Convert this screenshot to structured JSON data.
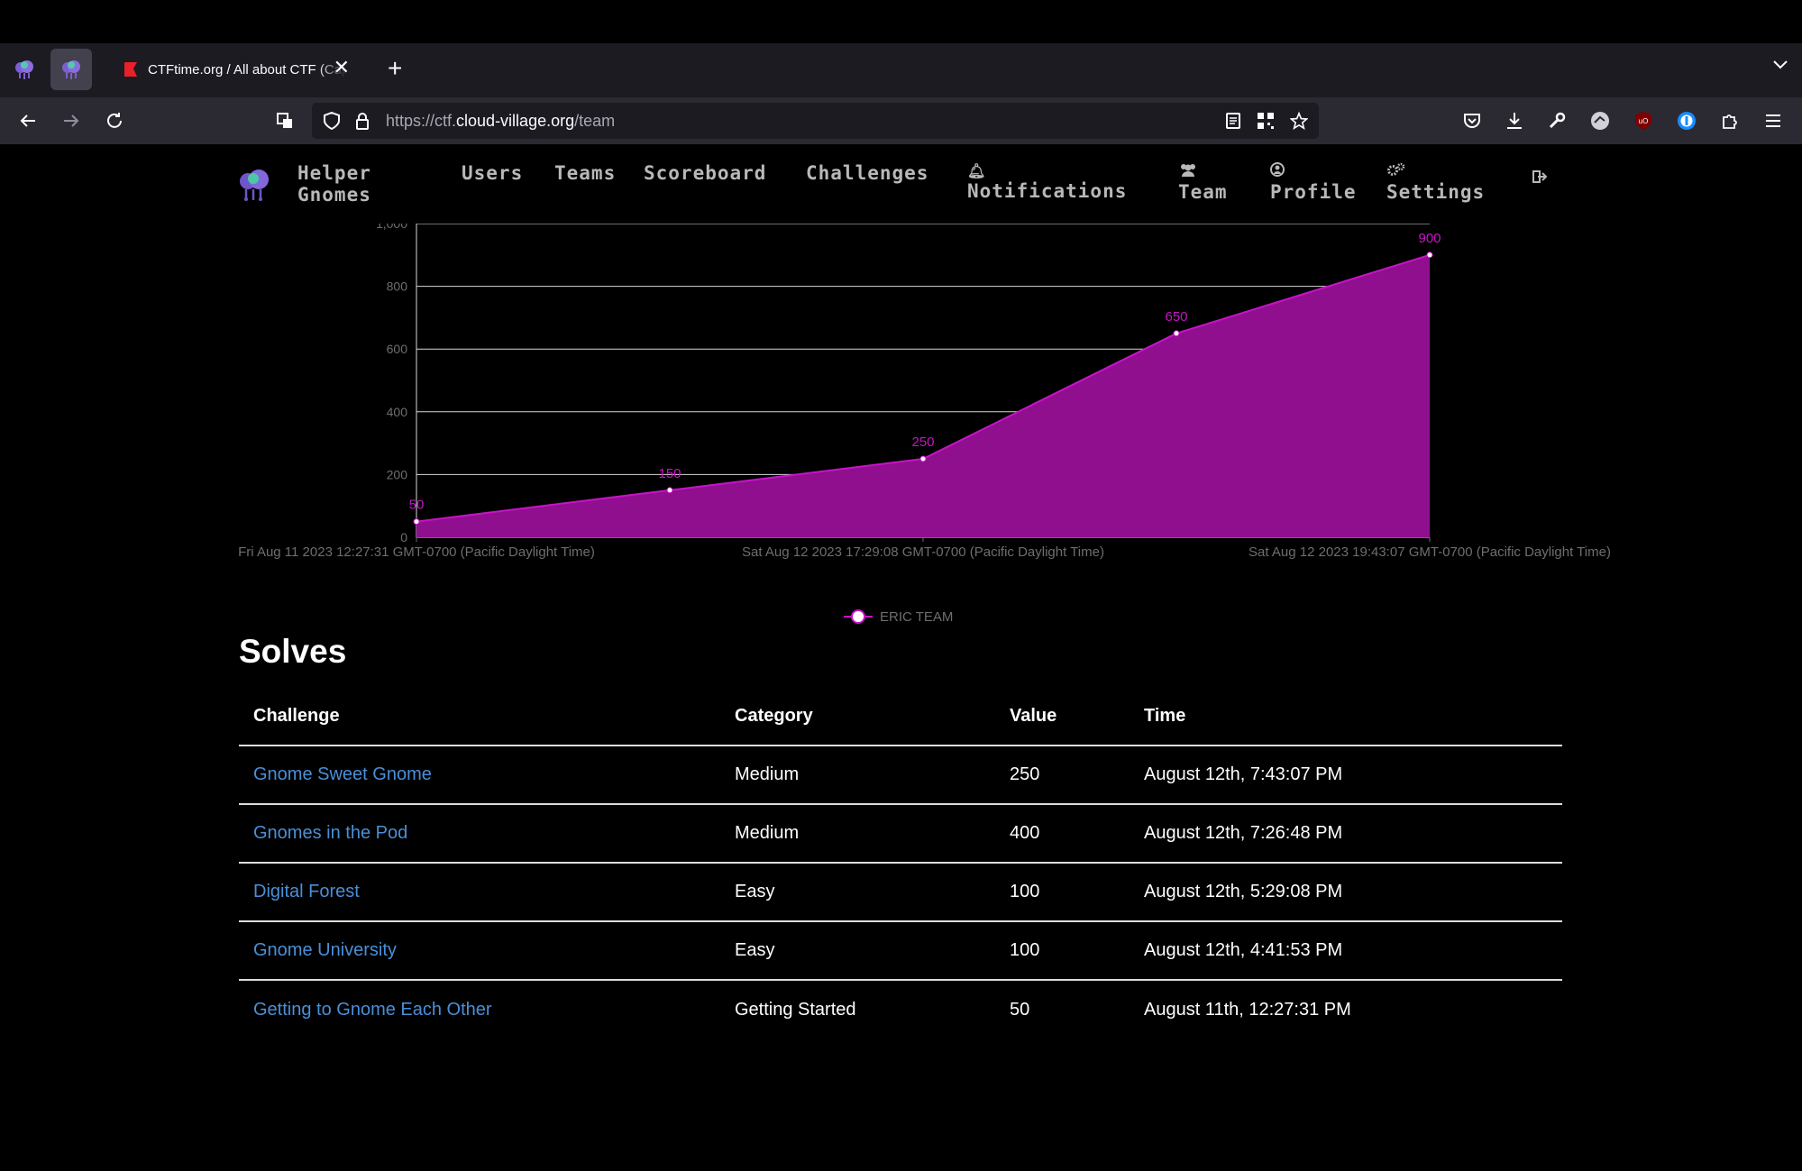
{
  "browser": {
    "tab": {
      "title": "CTFtime.org / All about CTF (Capture The Flag)",
      "close": "✕"
    },
    "new_tab": "+",
    "url": {
      "prefix": "https://ctf.",
      "host": "cloud-village.org",
      "path": "/team"
    }
  },
  "site": {
    "brand": "Helper Gnomes",
    "nav": {
      "users": "Users",
      "teams": "Teams",
      "scoreboard": "Scoreboard",
      "challenges": "Challenges",
      "notifications": "Notifications",
      "team": "Team",
      "profile": "Profile",
      "settings": "Settings"
    }
  },
  "colors": {
    "accent": "#c814c8",
    "area_fill": "#8f0f8f",
    "link": "#4a8fd8"
  },
  "chart_data": {
    "type": "area",
    "y_tick_labels": [
      "0",
      "200",
      "400",
      "600",
      "800",
      "1,000"
    ],
    "ylim": [
      0,
      1000
    ],
    "x_tick_labels": [
      "Fri Aug 11 2023 12:27:31 GMT-0700 (Pacific Daylight Time)",
      "Sat Aug 12 2023 17:29:08 GMT-0700 (Pacific Daylight Time)",
      "Sat Aug 12 2023 19:43:07 GMT-0700 (Pacific Daylight Time)"
    ],
    "grid": true,
    "legend_position": "bottom-center",
    "series": [
      {
        "name": "ERIC TEAM",
        "x": [
          "Fri Aug 11 2023 12:27:31",
          "Sat Aug 12 2023 16:41:53",
          "Sat Aug 12 2023 17:29:08",
          "Sat Aug 12 2023 19:26:48",
          "Sat Aug 12 2023 19:43:07"
        ],
        "values": [
          50,
          150,
          250,
          650,
          900
        ],
        "point_labels": [
          "50",
          "150",
          "250",
          "650",
          "900"
        ]
      }
    ]
  },
  "solves": {
    "title": "Solves",
    "columns": [
      "Challenge",
      "Category",
      "Value",
      "Time"
    ],
    "rows": [
      {
        "challenge": "Gnome Sweet Gnome",
        "category": "Medium",
        "value": "250",
        "time": "August 12th, 7:43:07 PM"
      },
      {
        "challenge": "Gnomes in the Pod",
        "category": "Medium",
        "value": "400",
        "time": "August 12th, 7:26:48 PM"
      },
      {
        "challenge": "Digital Forest",
        "category": "Easy",
        "value": "100",
        "time": "August 12th, 5:29:08 PM"
      },
      {
        "challenge": "Gnome University",
        "category": "Easy",
        "value": "100",
        "time": "August 12th, 4:41:53 PM"
      },
      {
        "challenge": "Getting to Gnome Each Other",
        "category": "Getting Started",
        "value": "50",
        "time": "August 11th, 12:27:31 PM"
      }
    ]
  }
}
